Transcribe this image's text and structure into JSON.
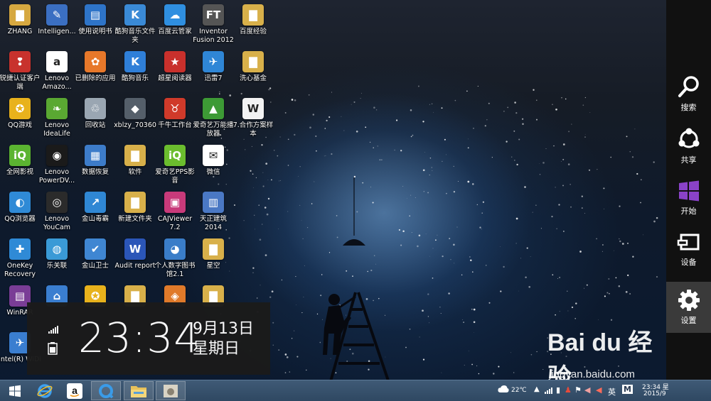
{
  "desktop": {
    "icons": [
      {
        "label": "ZHANG",
        "color": "#d6a840",
        "symbol": "▇",
        "col": 0,
        "row": 0
      },
      {
        "label": "Intelligen...",
        "color": "#3b6fc2",
        "symbol": "✎",
        "col": 1,
        "row": 0
      },
      {
        "label": "使用说明书",
        "color": "#2e74c8",
        "symbol": "▤",
        "col": 2,
        "row": 0
      },
      {
        "label": "酷狗音乐文件夹",
        "color": "#3a8ad6",
        "symbol": "K",
        "col": 3,
        "row": 0
      },
      {
        "label": "百度云管家",
        "color": "#2f8fe0",
        "symbol": "☁",
        "col": 4,
        "row": 0
      },
      {
        "label": "Inventor Fusion 2012",
        "color": "#555555",
        "symbol": "FT",
        "col": 5,
        "row": 0
      },
      {
        "label": "百度经验",
        "color": "#d8b04a",
        "symbol": "▇",
        "col": 6,
        "row": 0
      },
      {
        "label": "锐捷认证客户端",
        "color": "#c8322d",
        "symbol": "❢",
        "col": 0,
        "row": 1
      },
      {
        "label": "Lenovo Amazo...",
        "color": "#ffffff",
        "symbol": "a",
        "col": 1,
        "row": 1
      },
      {
        "label": "已删除的应用",
        "color": "#e7782a",
        "symbol": "✿",
        "col": 2,
        "row": 1
      },
      {
        "label": "酷狗音乐",
        "color": "#2f7fd8",
        "symbol": "K",
        "col": 3,
        "row": 1
      },
      {
        "label": "超星阅读器",
        "color": "#c9302c",
        "symbol": "★",
        "col": 4,
        "row": 1
      },
      {
        "label": "迅雷7",
        "color": "#2f86d6",
        "symbol": "✈",
        "col": 5,
        "row": 1
      },
      {
        "label": "洗心基金",
        "color": "#d8b04a",
        "symbol": "▇",
        "col": 6,
        "row": 1
      },
      {
        "label": "QQ游戏",
        "color": "#e8b21c",
        "symbol": "✪",
        "col": 0,
        "row": 2
      },
      {
        "label": "Lenovo IdeaLife",
        "color": "#5aa832",
        "symbol": "❧",
        "col": 1,
        "row": 2
      },
      {
        "label": "回收站",
        "color": "#9aa6b2",
        "symbol": "♲",
        "col": 2,
        "row": 2
      },
      {
        "label": "xblzy_70360",
        "color": "#555f6a",
        "symbol": "◆",
        "col": 3,
        "row": 2
      },
      {
        "label": "千牛工作台",
        "color": "#d03a2a",
        "symbol": "♉",
        "col": 4,
        "row": 2
      },
      {
        "label": "爱奇艺万能播放器",
        "color": "#3d9a35",
        "symbol": "▲",
        "col": 5,
        "row": 2
      },
      {
        "label": "7.合作方案样本",
        "color": "#f2f2f2",
        "symbol": "W",
        "col": 6,
        "row": 2
      },
      {
        "label": "全网影视",
        "color": "#5bb431",
        "symbol": "iQ",
        "col": 0,
        "row": 3
      },
      {
        "label": "Lenovo PowerDV...",
        "color": "#1a1a1a",
        "symbol": "◉",
        "col": 1,
        "row": 3
      },
      {
        "label": "数据恢复",
        "color": "#3d7cc9",
        "symbol": "▦",
        "col": 2,
        "row": 3
      },
      {
        "label": "软件",
        "color": "#d8b04a",
        "symbol": "▇",
        "col": 3,
        "row": 3
      },
      {
        "label": "爱奇艺PPS影音",
        "color": "#6bbd2e",
        "symbol": "iQ",
        "col": 4,
        "row": 3
      },
      {
        "label": "微信",
        "color": "#ffffff",
        "symbol": "✉",
        "col": 5,
        "row": 3
      },
      {
        "label": "QQ浏览器",
        "color": "#2f8ad6",
        "symbol": "◐",
        "col": 0,
        "row": 4
      },
      {
        "label": "Lenovo YouCam",
        "color": "#2b2b2b",
        "symbol": "◎",
        "col": 1,
        "row": 4
      },
      {
        "label": "金山毒霸",
        "color": "#2f87d4",
        "symbol": "↗",
        "col": 2,
        "row": 4
      },
      {
        "label": "新建文件夹",
        "color": "#d8b04a",
        "symbol": "▇",
        "col": 3,
        "row": 4
      },
      {
        "label": "CAJViewer 7.2",
        "color": "#c83a7a",
        "symbol": "▣",
        "col": 4,
        "row": 4
      },
      {
        "label": "天正建筑2014",
        "color": "#4a78c4",
        "symbol": "▥",
        "col": 5,
        "row": 4
      },
      {
        "label": "OneKey Recovery",
        "color": "#2f8ad6",
        "symbol": "✚",
        "col": 0,
        "row": 5
      },
      {
        "label": "乐关联",
        "color": "#3a9ad6",
        "symbol": "◍",
        "col": 1,
        "row": 5
      },
      {
        "label": "金山卫士",
        "color": "#3f86d2",
        "symbol": "✔",
        "col": 2,
        "row": 5
      },
      {
        "label": "Audit report",
        "color": "#2b56b8",
        "symbol": "W",
        "col": 3,
        "row": 5
      },
      {
        "label": "个人数字图书馆2.1",
        "color": "#3a7dc8",
        "symbol": "◕",
        "col": 4,
        "row": 5
      },
      {
        "label": "星空",
        "color": "#d8b04a",
        "symbol": "▇",
        "col": 5,
        "row": 5
      },
      {
        "label": "WinRAR",
        "color": "#7a3d96",
        "symbol": "▤",
        "col": 0,
        "row": 6
      },
      {
        "label": "",
        "color": "#3a7ed0",
        "symbol": "⌂",
        "col": 1,
        "row": 6
      },
      {
        "label": "",
        "color": "#e8b21c",
        "symbol": "✪",
        "col": 2,
        "row": 6
      },
      {
        "label": "",
        "color": "#d8b04a",
        "symbol": "▇",
        "col": 3,
        "row": 6
      },
      {
        "label": "",
        "color": "#e07a2a",
        "symbol": "◈",
        "col": 4,
        "row": 6
      },
      {
        "label": "",
        "color": "#d8b04a",
        "symbol": "▇",
        "col": 5,
        "row": 6
      },
      {
        "label": "Intel(R) WiDi",
        "color": "#3a7ed0",
        "symbol": "✈",
        "col": 0,
        "row": 7
      }
    ]
  },
  "clock": {
    "time": "23:34",
    "date": "9月13日",
    "weekday": "星期日"
  },
  "charms": [
    {
      "label": "搜索",
      "icon": "search-icon"
    },
    {
      "label": "共享",
      "icon": "share-icon"
    },
    {
      "label": "开始",
      "icon": "windows-start-icon"
    },
    {
      "label": "设备",
      "icon": "devices-icon"
    },
    {
      "label": "设置",
      "icon": "gear-icon"
    }
  ],
  "taskbar": {
    "apps": [
      {
        "name": "start-button",
        "icon": "windows-logo-icon"
      },
      {
        "name": "internet-explorer",
        "icon": "ie-icon"
      },
      {
        "name": "amazon",
        "icon": "amazon-icon"
      },
      {
        "name": "qq-browser",
        "icon": "qq-browser-icon"
      },
      {
        "name": "file-explorer",
        "icon": "folder-icon"
      },
      {
        "name": "photo-app",
        "icon": "photo-icon"
      }
    ],
    "tray": {
      "weather": "22℃",
      "ime": "英",
      "time": "23:34 星",
      "date": "2015/9"
    }
  },
  "watermark": {
    "brand": "Bai du 经验",
    "url": "jingyan.baidu.com"
  }
}
